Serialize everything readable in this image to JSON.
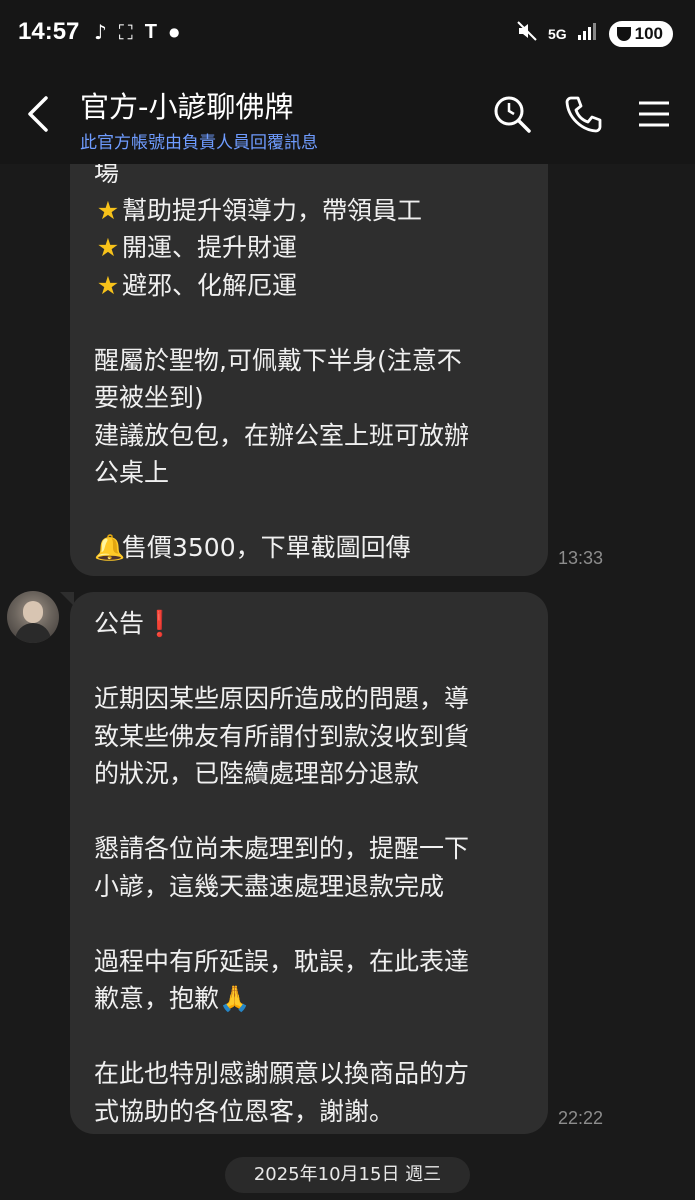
{
  "status_bar": {
    "time": "14:57",
    "network": "5G",
    "battery": "100"
  },
  "header": {
    "title": "官方-小諺聊佛牌",
    "subtitle": "此官方帳號由負責人員回覆訊息"
  },
  "messages": [
    {
      "lines": [
        "場",
        "★幫助提升領導力，帶領員工",
        "★開運、提升財運",
        "★避邪、化解厄運",
        "",
        "醒屬於聖物,可佩戴下半身(注意不",
        "要被坐到)",
        "建議放包包，在辦公室上班可放辦",
        "公桌上",
        "",
        "售價3500，下單截圖回傳"
      ],
      "time": "13:33"
    },
    {
      "lines": [
        "公告",
        "",
        "近期因某些原因所造成的問題，導",
        "致某些佛友有所謂付到款沒收到貨",
        "的狀況，已陸續處理部分退款",
        "",
        "懇請各位尚未處理到的，提醒一下",
        "小諺，這幾天盡速處理退款完成",
        "",
        "過程中有所延誤，耽誤，在此表達",
        "歉意，抱歉",
        "",
        "在此也特別感謝願意以換商品的方",
        "式協助的各位恩客，謝謝。"
      ],
      "time": "22:22"
    }
  ],
  "date_separator": "2025年10月15日 週三",
  "colors": {
    "background": "#1a1a1a",
    "bubble": "#2e2e2e",
    "subtitle": "#6f9cff",
    "timestamp": "#8d8d8d"
  },
  "icons": [
    "back-arrow-icon",
    "search-icon",
    "phone-icon",
    "menu-icon",
    "star-icon",
    "bell-icon",
    "exclamation-icon",
    "praying-hands-icon"
  ]
}
